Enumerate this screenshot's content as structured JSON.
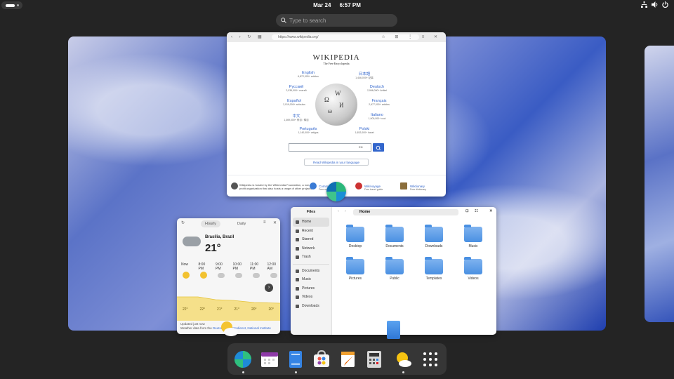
{
  "topbar": {
    "date": "Mar 24",
    "time": "6:57 PM"
  },
  "search": {
    "placeholder": "Type to search"
  },
  "browser": {
    "url": "https://www.wikipedia.org/",
    "logo_title": "WIKIPEDIA",
    "logo_subtitle": "The Free Encyclopedia",
    "languages": [
      {
        "name": "English",
        "count": "6,872,000+ articles"
      },
      {
        "name": "日本語",
        "count": "1,446,000+ 記事"
      },
      {
        "name": "Русский",
        "count": "2,035,000+ статей"
      },
      {
        "name": "Deutsch",
        "count": "2,966,000+ Artikel"
      },
      {
        "name": "Español",
        "count": "2,019,000+ artículos"
      },
      {
        "name": "Français",
        "count": "2,677,000+ articles"
      },
      {
        "name": "中文",
        "count": "1,469,000+ 条目 / 條目"
      },
      {
        "name": "Italiano",
        "count": "1,900,000+ voci"
      },
      {
        "name": "Português",
        "count": "1,140,000+ artigos"
      },
      {
        "name": "Polski",
        "count": "1,652,000+ haseł"
      }
    ],
    "search_lang": "EN",
    "read_in_language": "Read Wikipedia in your language",
    "footer_about": "Wikipedia is hosted by the Wikimedia Foundation, a non-profit organization that also hosts a range of other projects.",
    "projects": [
      {
        "name": "Commons",
        "desc": "Free media"
      },
      {
        "name": "Wikivoyage",
        "desc": "Free travel guide"
      },
      {
        "name": "Wiktionary",
        "desc": "Free dictionary"
      }
    ]
  },
  "weather": {
    "tab_hourly": "Hourly",
    "tab_daily": "Daily",
    "location": "Brasília, Brazil",
    "temperature": "21°",
    "hours": [
      "Now",
      "8:00 PM",
      "9:00 PM",
      "10:00 PM",
      "11:00 PM",
      "12:00 AM"
    ],
    "hour_temps": [
      "22°",
      "22°",
      "21°",
      "21°",
      "20°",
      "20°"
    ],
    "updated": "Updated just now",
    "source_prefix": "Weather data from the",
    "source_link": "Deutscher Wetterdienst, National Institute"
  },
  "files": {
    "title": "Files",
    "path": "Home",
    "sidebar": [
      "Home",
      "Recent",
      "Starred",
      "Network",
      "Trash"
    ],
    "bookmarks": [
      "Documents",
      "Music",
      "Pictures",
      "Videos",
      "Downloads"
    ],
    "folders": [
      "Desktop",
      "Documents",
      "Downloads",
      "Music",
      "Pictures",
      "Public",
      "Templates",
      "Videos"
    ]
  }
}
